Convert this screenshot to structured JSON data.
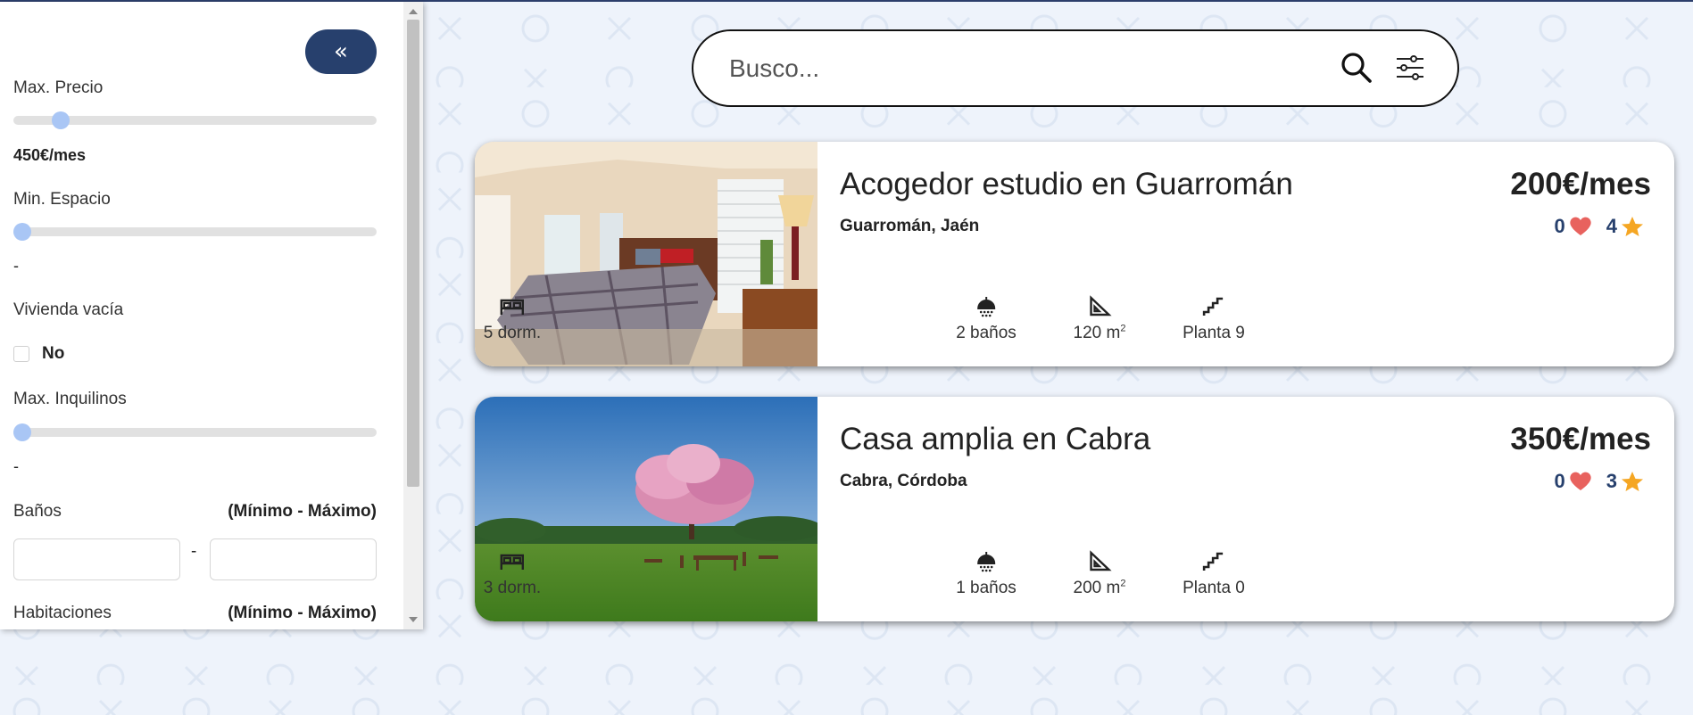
{
  "sidebar": {
    "collapse_label": "«",
    "max_price": {
      "label": "Max. Precio",
      "value": "450€/mes",
      "slider_fraction": 0.11
    },
    "min_space": {
      "label": "Min. Espacio",
      "value": "-",
      "slider_fraction": 0.0
    },
    "empty_home": {
      "label": "Vivienda vacía",
      "option_label": "No",
      "checked": false
    },
    "max_tenants": {
      "label": "Max. Inquilinos",
      "value": "-",
      "slider_fraction": 0.0
    },
    "bathrooms": {
      "label": "Baños",
      "hint": "(Mínimo - Máximo)",
      "separator": "-",
      "min_value": "",
      "max_value": ""
    },
    "rooms": {
      "label": "Habitaciones",
      "hint": "(Mínimo - Máximo)"
    }
  },
  "search": {
    "placeholder": "Busco...",
    "value": ""
  },
  "listings": [
    {
      "title": "Acogedor estudio en Guarromán",
      "location": "Guarromán, Jaén",
      "price": "200€/mes",
      "likes": "0",
      "rating": "4",
      "bedrooms": "5 dorm.",
      "bathrooms": "2 baños",
      "area": "120 m",
      "area_unit_sup": "2",
      "floor": "Planta 9"
    },
    {
      "title": "Casa amplia en Cabra",
      "location": "Cabra, Córdoba",
      "price": "350€/mes",
      "likes": "0",
      "rating": "3",
      "bedrooms": "3 dorm.",
      "bathrooms": "1 baños",
      "area": "200 m",
      "area_unit_sup": "2",
      "floor": "Planta 0"
    }
  ],
  "colors": {
    "primary": "#27406d",
    "background": "#eef3fb",
    "heart": "#e8625e",
    "star": "#f5a623",
    "slider_thumb": "#a9c6f5"
  }
}
